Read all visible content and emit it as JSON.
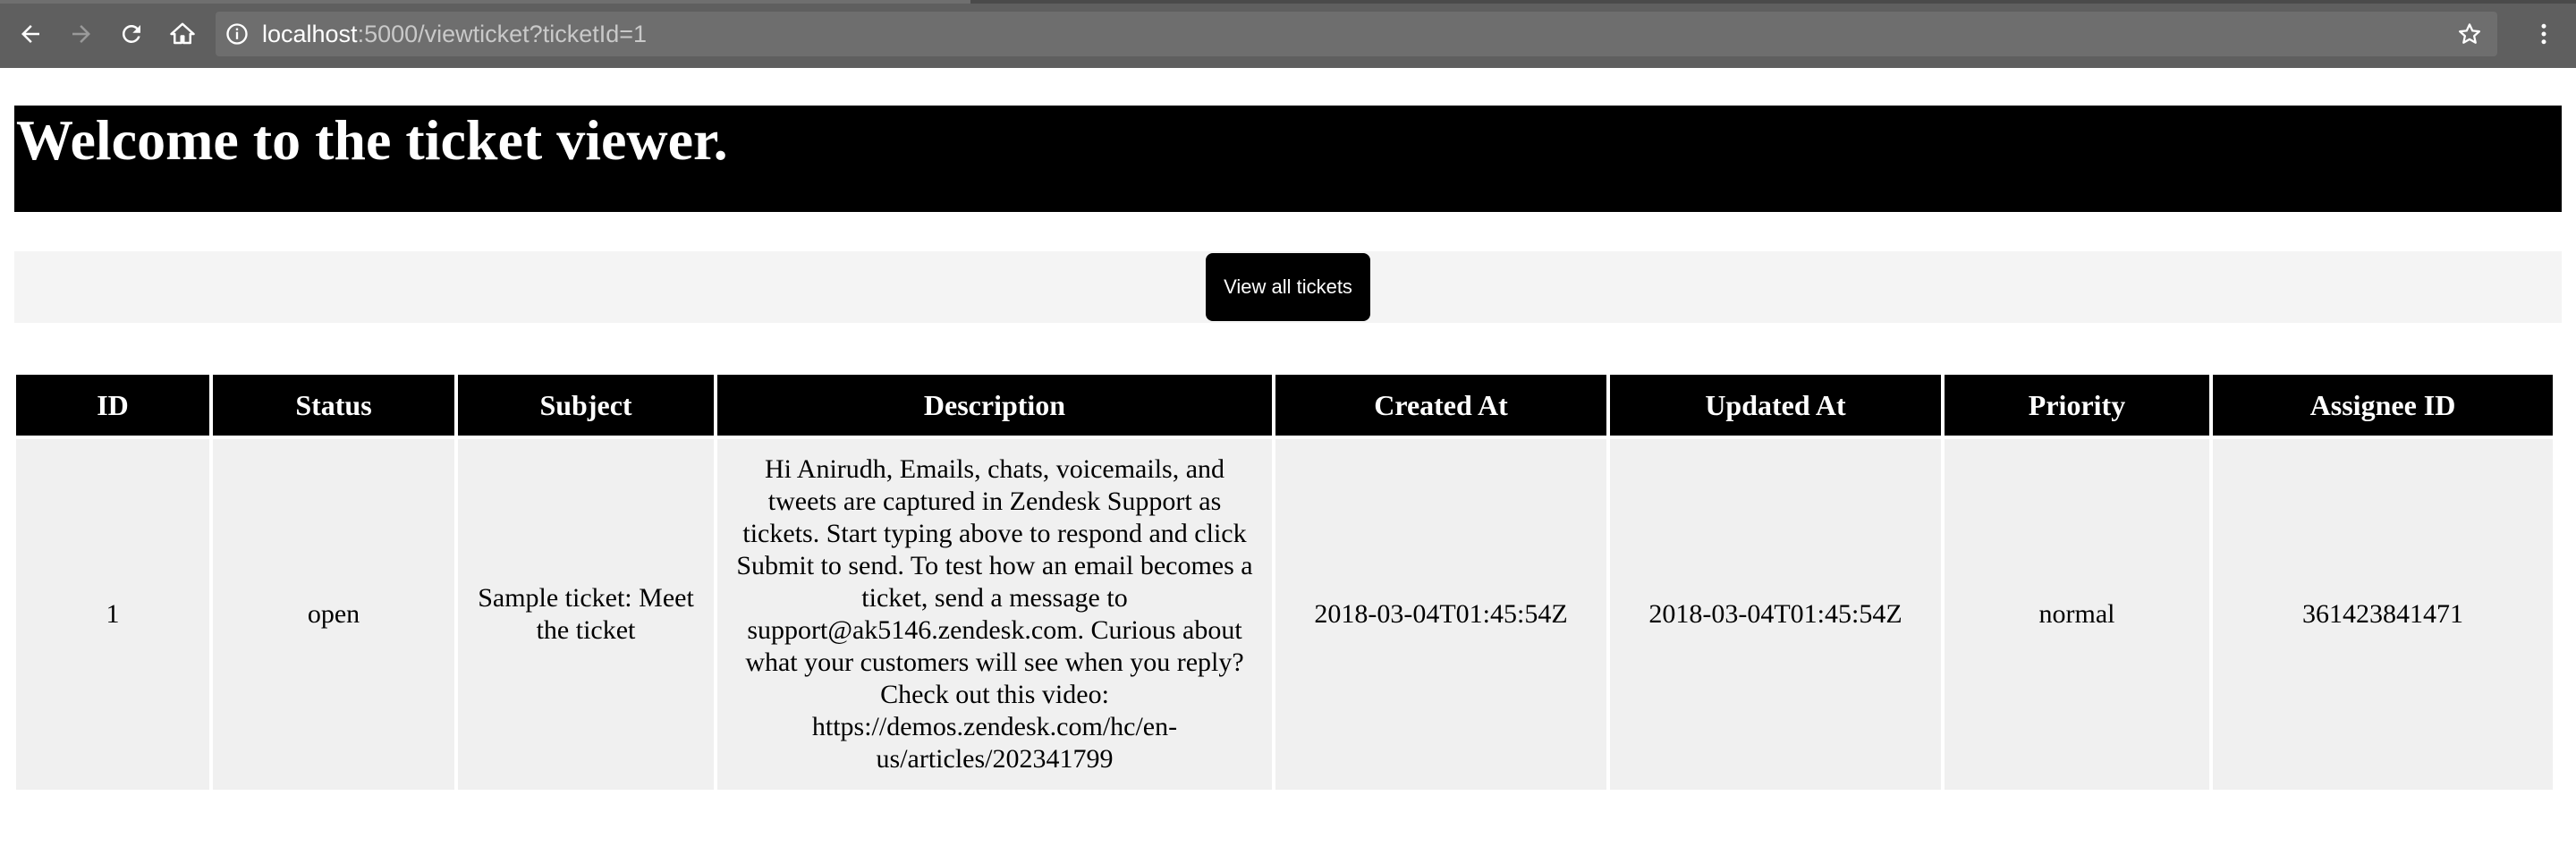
{
  "browser": {
    "url_host": "localhost",
    "url_rest": ":5000/viewticket?ticketId=1",
    "icons": {
      "back": "back-arrow-icon",
      "forward": "forward-arrow-icon",
      "reload": "reload-icon",
      "home": "home-icon",
      "info": "info-icon",
      "star": "star-icon",
      "menu": "kebab-menu-icon"
    }
  },
  "header": {
    "title": "Welcome to the ticket viewer."
  },
  "actions": {
    "view_all_label": "View all tickets"
  },
  "table": {
    "headers": [
      "ID",
      "Status",
      "Subject",
      "Description",
      "Created At",
      "Updated At",
      "Priority",
      "Assignee ID"
    ],
    "rows": [
      {
        "id": "1",
        "status": "open",
        "subject": "Sample ticket: Meet the ticket",
        "description": "Hi Anirudh, Emails, chats, voicemails, and tweets are captured in Zendesk Support as tickets. Start typing above to respond and click Submit to send. To test how an email becomes a ticket, send a message to support@ak5146.zendesk.com. Curious about what your customers will see when you reply? Check out this video: https://demos.zendesk.com/hc/en-us/articles/202341799",
        "created_at": "2018-03-04T01:45:54Z",
        "updated_at": "2018-03-04T01:45:54Z",
        "priority": "normal",
        "assignee_id": "361423841471"
      }
    ]
  },
  "colors": {
    "chrome": "#5f5f5f",
    "omnibox": "#6e6e6e",
    "header_bg": "#000000",
    "header_text": "#ffffff",
    "action_bar_bg": "#f4f4f4",
    "cell_bg": "#f0f0f0"
  }
}
